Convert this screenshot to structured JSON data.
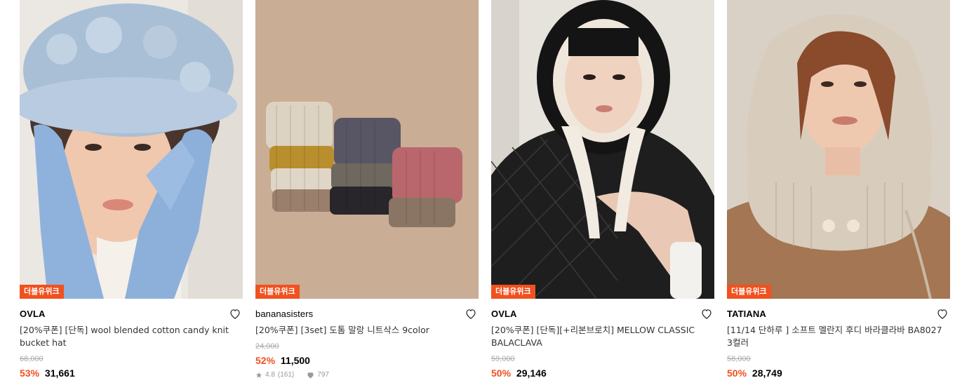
{
  "products": [
    {
      "badge": "더블유위크",
      "brand": "OVLA",
      "title": "[20%쿠폰] [단독] wool blended cotton candy knit bucket hat",
      "original_price": "68,000",
      "discount": "53%",
      "price": "31,661",
      "image_alt": "woman in light blue fuzzy bucket hat and blue knit gloves"
    },
    {
      "badge": "더블유위크",
      "brand": "bananasisters",
      "title": "[20%쿠폰] [3set] 도톰 말랑 니트삭스 9color",
      "original_price": "24,000",
      "discount": "52%",
      "price": "11,500",
      "rating": "4.8",
      "review_count": "(161)",
      "likes": "797",
      "image_alt": "stacked folded knit socks in nine colors on beige background"
    },
    {
      "badge": "더블유위크",
      "brand": "OVLA",
      "title": "[20%쿠폰] [단독][+리본브로치] MELLOW CLASSIC BALACLAVA",
      "original_price": "59,000",
      "discount": "50%",
      "price": "29,146",
      "image_alt": "woman wearing black fluffy balaclava and quilted jacket"
    },
    {
      "badge": "더블유위크",
      "brand": "TATIANA",
      "title": "[11/14 단하루 ] 소프트 멜란지 후디 바라클라바 BA8027 3컬러",
      "original_price": "58,000",
      "discount": "50%",
      "price": "28,749",
      "image_alt": "woman wearing beige knit hooded balaclava cape"
    }
  ],
  "colors": {
    "accent": "#f0511f",
    "muted": "#aaaaaa"
  },
  "icons": {
    "heart": "heart-outline-icon",
    "star": "star-icon"
  }
}
